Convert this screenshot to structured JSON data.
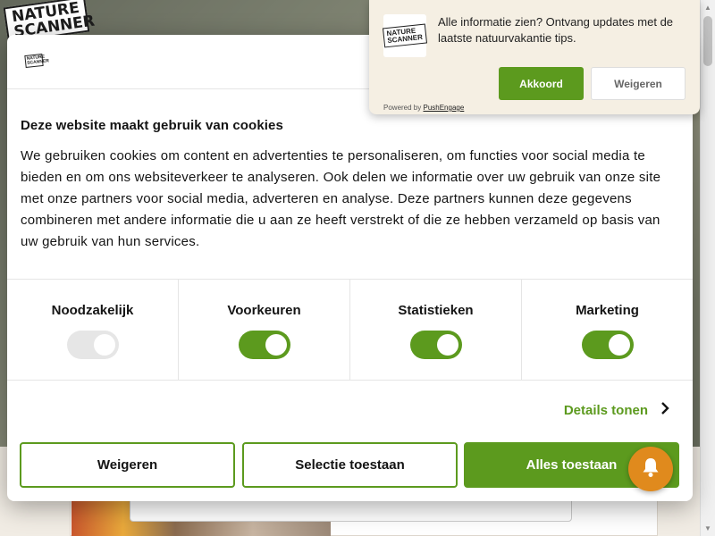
{
  "background": {
    "logo_line1": "NATURE",
    "logo_line2": "SCANNER"
  },
  "cookie": {
    "logo_line1": "NATURE",
    "logo_line2": "SCANNER",
    "title": "Deze website maakt gebruik van cookies",
    "text": "We gebruiken cookies om content en advertenties te personaliseren, om functies voor social media te bieden en om ons websiteverkeer te analyseren. Ook delen we informatie over uw gebruik van onze site met onze partners voor social media, adverteren en analyse. Deze partners kunnen deze gegevens combineren met andere informatie die u aan ze heeft verstrekt of die ze hebben verzameld op basis van uw gebruik van hun services.",
    "categories": [
      {
        "label": "Noodzakelijk",
        "enabled": true,
        "disabled": true
      },
      {
        "label": "Voorkeuren",
        "enabled": true,
        "disabled": false
      },
      {
        "label": "Statistieken",
        "enabled": true,
        "disabled": false
      },
      {
        "label": "Marketing",
        "enabled": true,
        "disabled": false
      }
    ],
    "details_label": "Details tonen",
    "buttons": {
      "deny": "Weigeren",
      "allow_selection": "Selectie toestaan",
      "allow_all": "Alles toestaan"
    }
  },
  "push": {
    "logo_line1": "NATURE",
    "logo_line2": "SCANNER",
    "message": "Alle informatie zien? Ontvang updates met de laatste natuurvakantie tips.",
    "accept": "Akkoord",
    "decline": "Weigeren",
    "powered_prefix": "Powered by",
    "powered_link": "PushEngage"
  },
  "colors": {
    "accent": "#5c9a1e",
    "bell": "#e08a1d",
    "push_bg": "#f5efe3"
  },
  "icons": {
    "bell": "bell-icon",
    "chevron": "chevron-right-icon"
  }
}
